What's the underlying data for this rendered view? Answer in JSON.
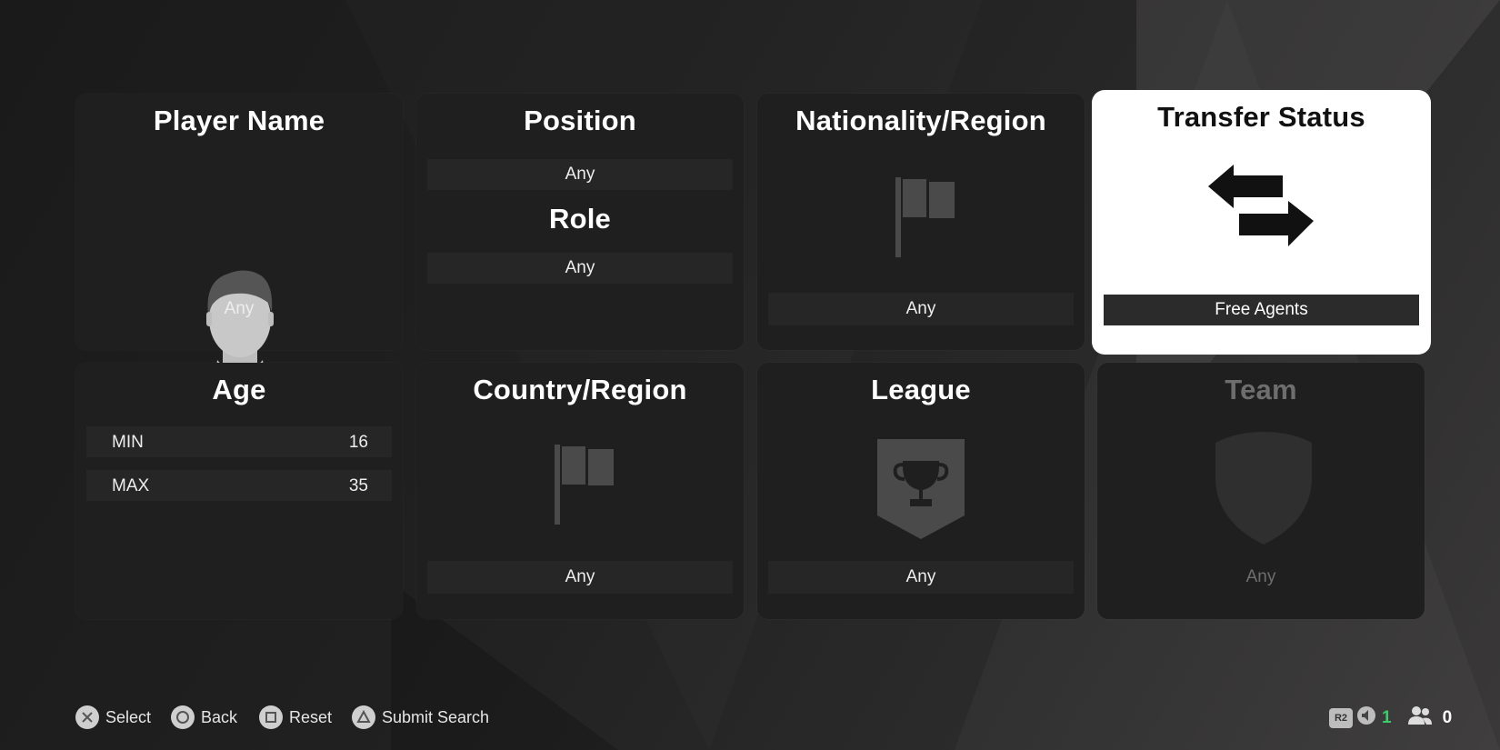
{
  "cards": {
    "player_name": {
      "title": "Player Name",
      "value": "Any"
    },
    "position": {
      "title": "Position",
      "value": "Any",
      "role_title": "Role",
      "role_value": "Any"
    },
    "nationality": {
      "title": "Nationality/Region",
      "value": "Any"
    },
    "transfer_status": {
      "title": "Transfer Status",
      "value": "Free Agents"
    },
    "age": {
      "title": "Age",
      "min_label": "MIN",
      "min_value": "16",
      "max_label": "MAX",
      "max_value": "35"
    },
    "country": {
      "title": "Country/Region",
      "value": "Any"
    },
    "league": {
      "title": "League",
      "value": "Any"
    },
    "team": {
      "title": "Team",
      "value": "Any"
    }
  },
  "footer": {
    "select": "Select",
    "back": "Back",
    "reset": "Reset",
    "submit": "Submit Search"
  },
  "status": {
    "r2_label": "R2",
    "speaker_count": "1",
    "players_count": "0"
  },
  "colors": {
    "card_bg": "#1f1f1f",
    "selected_bg": "#ffffff",
    "disabled_text": "#6e6e6e",
    "online_green": "#3ecb6b"
  }
}
